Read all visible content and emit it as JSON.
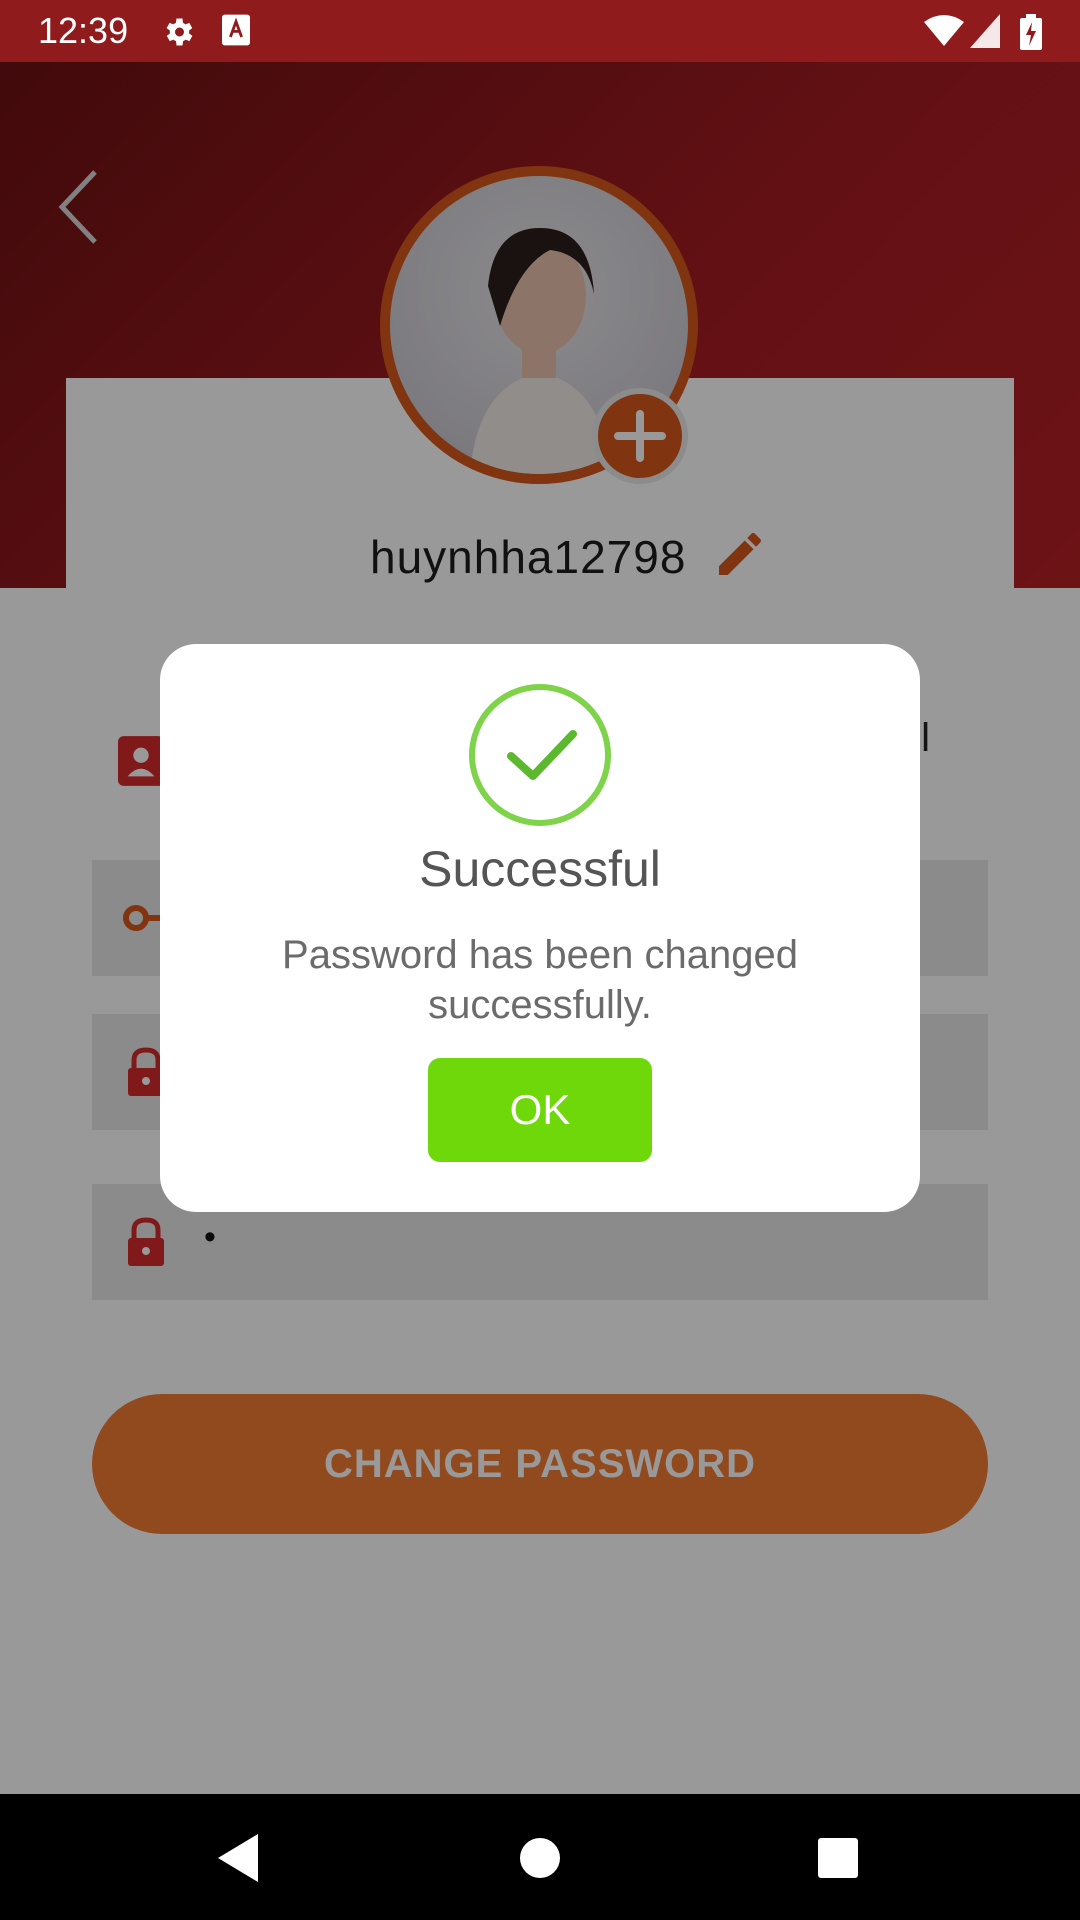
{
  "status_bar": {
    "time": "12:39",
    "icons": [
      "settings-icon",
      "keyboard-a-icon",
      "wifi-icon",
      "signal-icon",
      "battery-charging-icon"
    ]
  },
  "profile": {
    "username": "huynhha12798",
    "tab_partial_label": "ail"
  },
  "form": {
    "fields": [
      {
        "icon": "key-icon",
        "value": ""
      },
      {
        "icon": "lock-icon",
        "value": ""
      },
      {
        "icon": "lock-icon",
        "value": "•"
      }
    ],
    "submit_label": "CHANGE PASSWORD"
  },
  "dialog": {
    "title": "Successful",
    "message": "Password has been changed successfully.",
    "ok_label": "OK"
  },
  "colors": {
    "header_red": "#a61c22",
    "accent_orange": "#d6571a",
    "success_green": "#7ed34a",
    "ok_green": "#6fd80a"
  },
  "nav_bar": {
    "buttons": [
      "back-triangle-icon",
      "home-circle-icon",
      "recents-square-icon"
    ]
  }
}
